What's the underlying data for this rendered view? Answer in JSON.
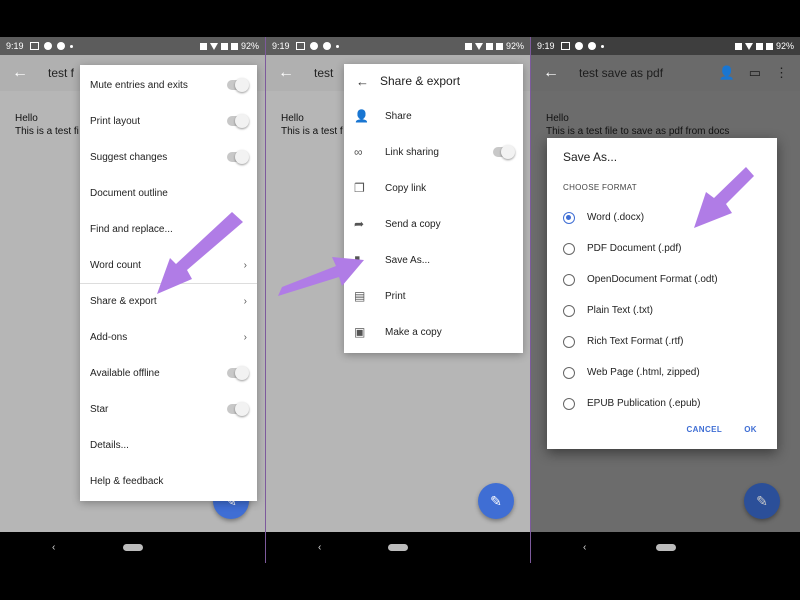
{
  "status": {
    "time": "9:19",
    "battery": "92%"
  },
  "phone1": {
    "title": "test f",
    "doc_lines": [
      "Hello",
      "This is a test fi"
    ],
    "menu": [
      {
        "label": "Mute entries and exits",
        "control": "toggle"
      },
      {
        "label": "Print layout",
        "control": "toggle"
      },
      {
        "label": "Suggest changes",
        "control": "toggle"
      },
      {
        "label": "Document outline",
        "control": "none"
      },
      {
        "label": "Find and replace...",
        "control": "none"
      },
      {
        "label": "Word count",
        "control": "chevron"
      },
      {
        "label": "Share & export",
        "control": "chevron"
      },
      {
        "label": "Add-ons",
        "control": "chevron"
      },
      {
        "label": "Available offline",
        "control": "toggle"
      },
      {
        "label": "Star",
        "control": "toggle"
      },
      {
        "label": "Details...",
        "control": "none"
      },
      {
        "label": "Help & feedback",
        "control": "none"
      }
    ]
  },
  "phone2": {
    "title": "test",
    "doc_lines": [
      "Hello",
      "This is a test f"
    ],
    "submenu_title": "Share & export",
    "items": [
      {
        "label": "Share",
        "icon": "add-person-icon"
      },
      {
        "label": "Link sharing",
        "icon": "link-icon"
      },
      {
        "label": "Copy link",
        "icon": "copy-icon"
      },
      {
        "label": "Send a copy",
        "icon": "send-icon"
      },
      {
        "label": "Save As...",
        "icon": "file-icon"
      },
      {
        "label": "Print",
        "icon": "print-icon"
      },
      {
        "label": "Make a copy",
        "icon": "copy-file-icon"
      }
    ]
  },
  "phone3": {
    "title": "test save as pdf",
    "doc_lines": [
      "Hello",
      "This is a test file to save as pdf from docs"
    ],
    "dialog": {
      "title": "Save As...",
      "subtitle": "CHOOSE FORMAT",
      "options": [
        "Word (.docx)",
        "PDF Document (.pdf)",
        "OpenDocument Format (.odt)",
        "Plain Text (.txt)",
        "Rich Text Format (.rtf)",
        "Web Page (.html, zipped)",
        "EPUB Publication (.epub)"
      ],
      "selected": "Word (.docx)",
      "cancel": "CANCEL",
      "ok": "OK"
    }
  },
  "colors": {
    "accent": "#3f6ed4",
    "arrow": "#b07ce6"
  }
}
